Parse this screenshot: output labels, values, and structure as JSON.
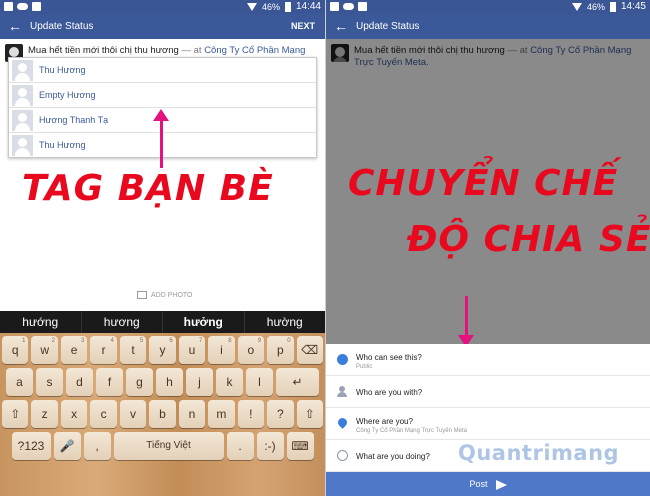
{
  "left": {
    "status_bar": {
      "battery": "46%",
      "time": "14:44"
    },
    "action_bar": {
      "back": "←",
      "title": "Update Status",
      "next": "NEXT"
    },
    "composer": {
      "text": "Mua hết tiền mới thôi chị thu hương",
      "at": " — at ",
      "place": "Công Ty Cổ Phần Mạng Trực"
    },
    "tag_suggestions": [
      "Thu Hương",
      "Empty Hương",
      "Hương Thanh Tạ",
      "Thu Hương"
    ],
    "annotation": "TAG BẠN BÈ",
    "add_photo": "ADD PHOTO",
    "suggestions": [
      "hướng",
      "hương",
      "hưởng",
      "hường"
    ],
    "keyboard": {
      "row1": [
        "q",
        "w",
        "e",
        "r",
        "t",
        "y",
        "u",
        "i",
        "o",
        "p",
        "⌫"
      ],
      "row1_alt": [
        "1",
        "2",
        "3",
        "4",
        "5",
        "6",
        "7",
        "8",
        "9",
        "0",
        ""
      ],
      "row2": [
        "a",
        "s",
        "d",
        "f",
        "g",
        "h",
        "j",
        "k",
        "l",
        "↵"
      ],
      "row3": [
        "⇧",
        "z",
        "x",
        "c",
        "v",
        "b",
        "n",
        "m",
        "!",
        "?",
        "⇧"
      ],
      "row4": [
        "?123",
        "🎤",
        ",",
        "Tiếng Việt",
        ".",
        ":-)",
        "⌨"
      ]
    }
  },
  "right": {
    "status_bar": {
      "battery": "46%",
      "time": "14:45"
    },
    "action_bar": {
      "back": "←",
      "title": "Update Status"
    },
    "composer": {
      "text": "Mua hết tiền mới thôi chị thu hương",
      "at": " — at ",
      "place": "Công Ty Cổ Phần Mạng Trực Tuyến Meta."
    },
    "annotation_line1": "CHUYỂN CHẾ",
    "annotation_line2": "ĐỘ CHIA SẺ",
    "options": [
      {
        "title": "Who can see this?",
        "sub": "Public"
      },
      {
        "title": "Who are you with?",
        "sub": ""
      },
      {
        "title": "Where are you?",
        "sub": "Công Ty Cổ Phần Mạng Trực Tuyến Meta"
      },
      {
        "title": "What are you doing?",
        "sub": ""
      }
    ],
    "post": "Post",
    "watermark": "Quantrimang"
  }
}
